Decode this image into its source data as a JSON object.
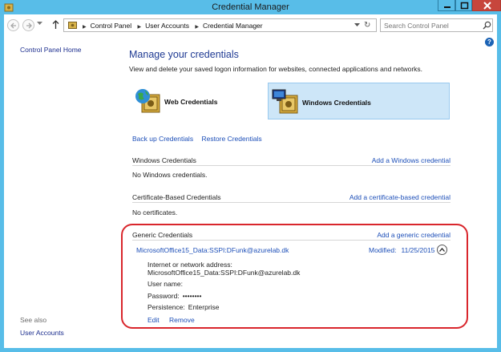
{
  "window": {
    "title": "Credential Manager"
  },
  "address": {
    "breadcrumbs": [
      "Control Panel",
      "User Accounts",
      "Credential Manager"
    ],
    "search_placeholder": "Search Control Panel"
  },
  "sidebar": {
    "home_link": "Control Panel Home",
    "see_also_label": "See also",
    "see_also_link": "User Accounts"
  },
  "main": {
    "heading": "Manage your credentials",
    "subheading": "View and delete your saved logon information for websites, connected applications and networks.",
    "tiles": [
      {
        "label": "Web Credentials",
        "icon": "globe-vault-icon",
        "selected": false
      },
      {
        "label": "Windows Credentials",
        "icon": "computer-vault-icon",
        "selected": true
      }
    ],
    "backup_link": "Back up Credentials",
    "restore_link": "Restore Credentials",
    "windows_section": {
      "title": "Windows Credentials",
      "add_link": "Add a Windows credential",
      "empty": "No Windows credentials."
    },
    "cert_section": {
      "title": "Certificate-Based Credentials",
      "add_link": "Add a certificate-based credential",
      "empty": "No certificates."
    },
    "generic_section": {
      "title": "Generic Credentials",
      "add_link": "Add a generic credential",
      "credential": {
        "name": "MicrosoftOffice15_Data:SSPI:DFunk@azurelab.dk",
        "modified_label": "Modified:",
        "modified_date": "11/25/2015",
        "address_label": "Internet or network address:",
        "address_value": "MicrosoftOffice15_Data:SSPI:DFunk@azurelab.dk",
        "username_label": "User name:",
        "password_label": "Password:",
        "password_value": "••••••••",
        "persistence_label": "Persistence:",
        "persistence_value": "Enterprise",
        "edit_link": "Edit",
        "remove_link": "Remove"
      }
    }
  },
  "colors": {
    "accent": "#1d4fb8",
    "heading": "#1f3a93",
    "titlebar": "#58bde8",
    "highlight": "#d9262c",
    "selected_tile": "#cde6f8"
  }
}
